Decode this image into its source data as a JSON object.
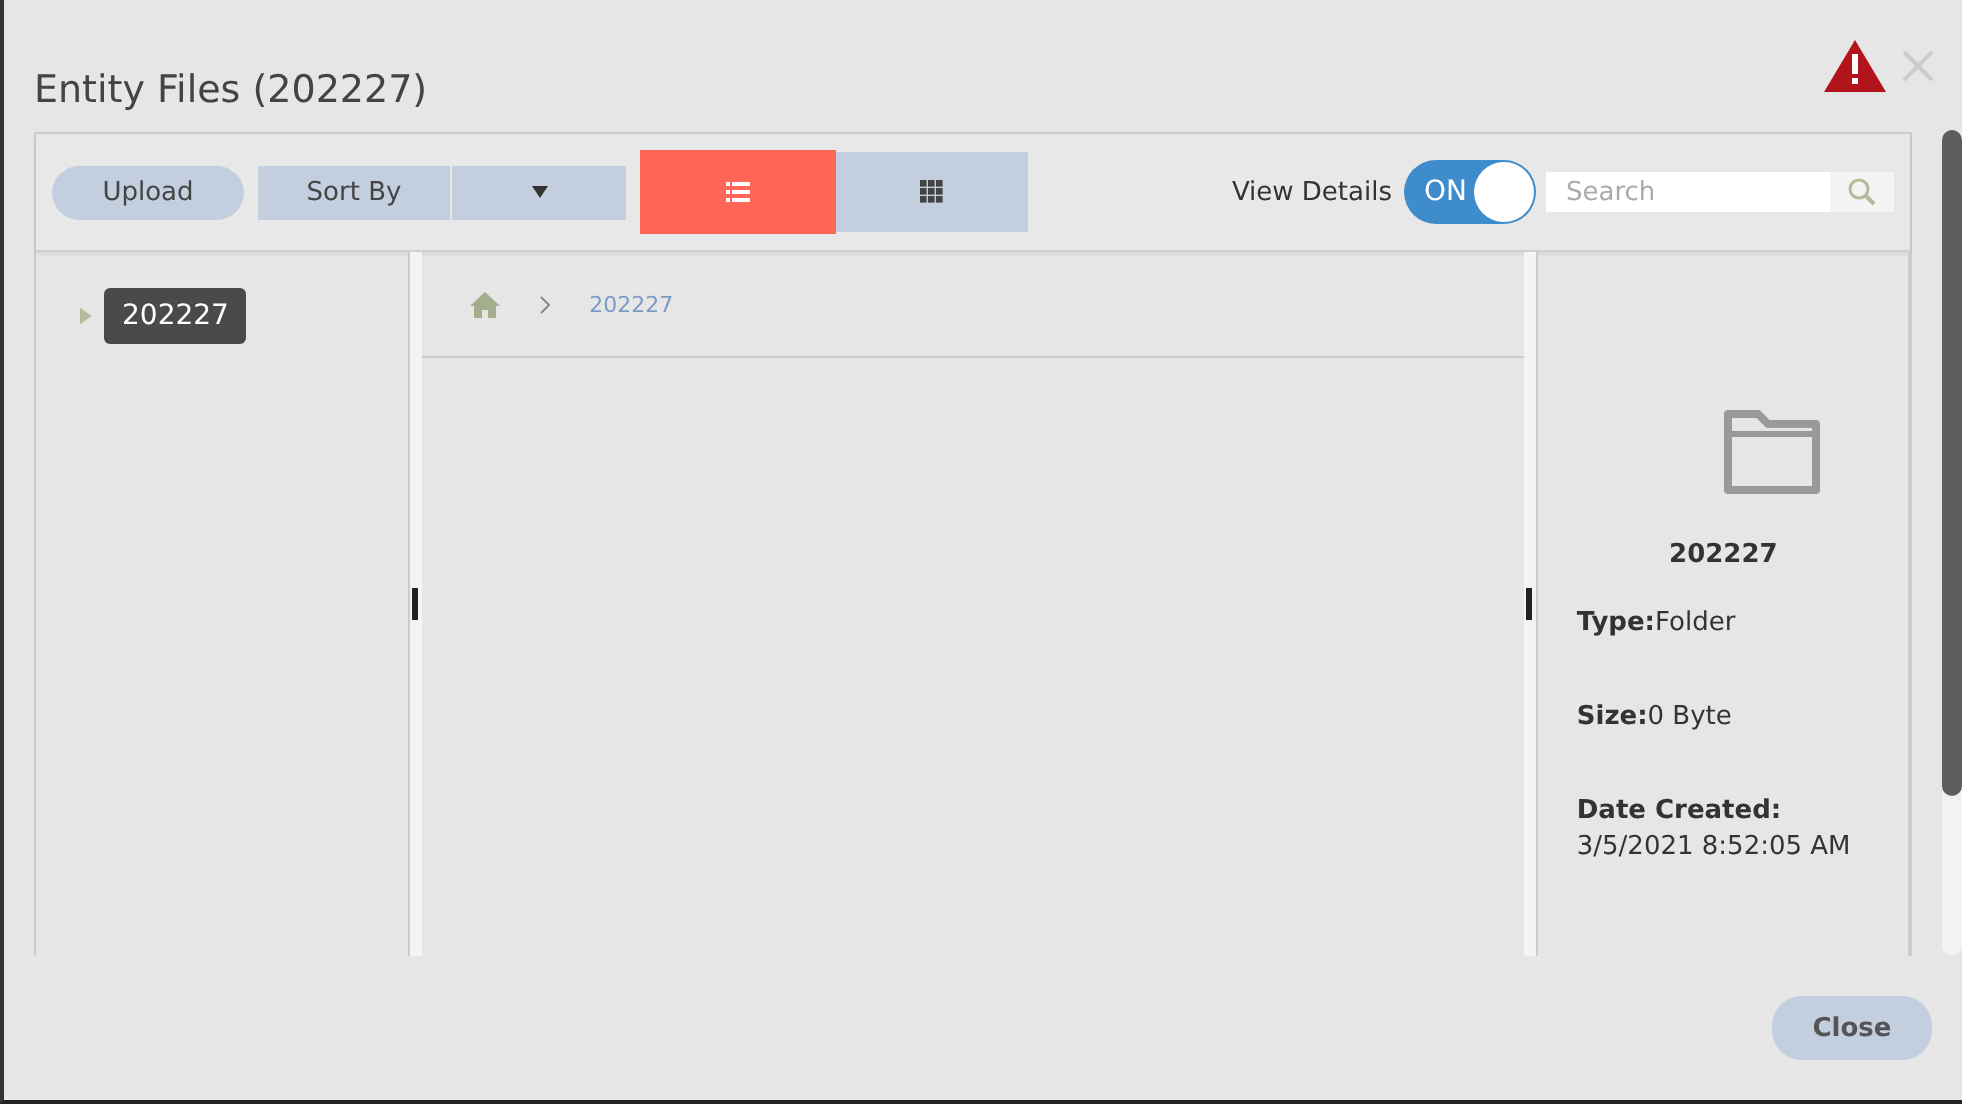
{
  "window": {
    "title": "Entity Files (202227)"
  },
  "toolbar": {
    "upload": "Upload",
    "sort_by": "Sort By",
    "views": [
      {
        "kind": "list",
        "selected": true
      },
      {
        "kind": "grid",
        "selected": false
      }
    ],
    "view_details": {
      "label": "View Details",
      "on": true,
      "state_text": "ON"
    },
    "search": {
      "placeholder": "Search"
    }
  },
  "tree": [
    {
      "label": "202227",
      "selected": true,
      "expanded": false
    }
  ],
  "breadcrumb": [
    "202227"
  ],
  "details": {
    "name": "202227",
    "fields": [
      {
        "kind": "inline",
        "label": "Type:",
        "value": "Folder"
      },
      {
        "kind": "inline",
        "label": "Size:",
        "value": "0 Byte"
      },
      {
        "kind": "stacked",
        "label": "Date Created:",
        "value": "3/5/2021 8:52:05 AM"
      }
    ]
  },
  "footer": {
    "close": "Close"
  }
}
